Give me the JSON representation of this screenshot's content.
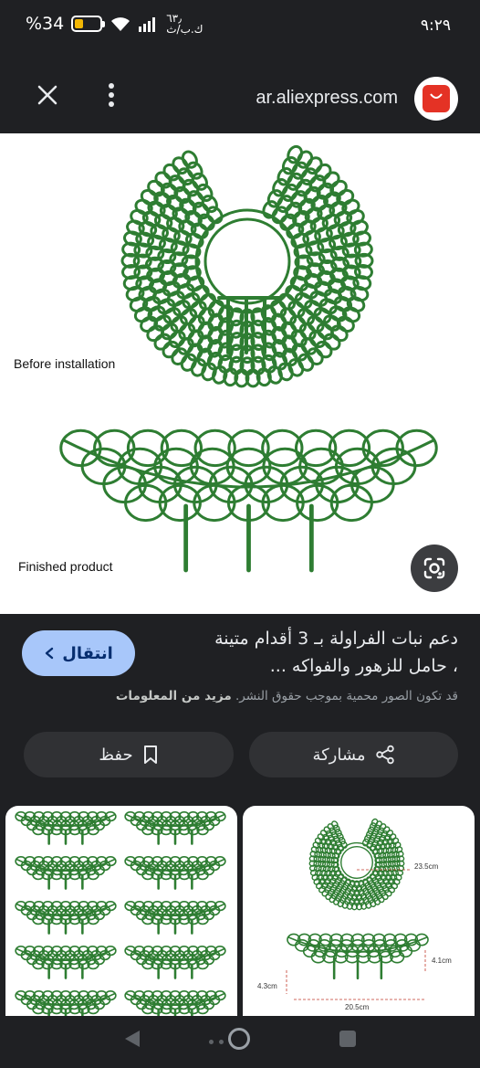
{
  "status_bar": {
    "time": "٩:٢٩",
    "battery_percent": "%34",
    "battery_level": 0.34,
    "net_speed_value": "٦٣٫",
    "net_speed_unit": "ك.ب/ث",
    "icons": [
      "wifi-icon",
      "signal-icon",
      "battery-icon"
    ]
  },
  "url_bar": {
    "url": "ar.aliexpress.com",
    "icons": [
      "close-icon",
      "more-vert-icon",
      "aliexpress-logo"
    ]
  },
  "image": {
    "caption_before": "Before installation",
    "caption_finished": "Finished product",
    "lens_icon": "google-lens-icon",
    "plant_color": "#2e7d32"
  },
  "info": {
    "title_line1": "دعم نبات الفراولة بـ 3 أقدام متينة",
    "title_line2": "، حامل للزهور والفواكه ...",
    "visit_label": "انتقال",
    "copyright_text": "قد تكون الصور محمية بموجب حقوق النشر.",
    "learn_more": "مزيد من المعلومات",
    "share_label": "مشاركة",
    "save_label": "حفظ"
  },
  "related": {
    "dims": {
      "top": "23.5cm",
      "height": "4.1cm",
      "leg": "4.3cm",
      "width": "20.5cm"
    }
  },
  "nav_bar": {
    "icons": [
      "back-icon",
      "home-icon",
      "recents-icon"
    ]
  },
  "colors": {
    "accent": "#a8c7fa",
    "background": "#1f2023",
    "button": "#303134"
  }
}
